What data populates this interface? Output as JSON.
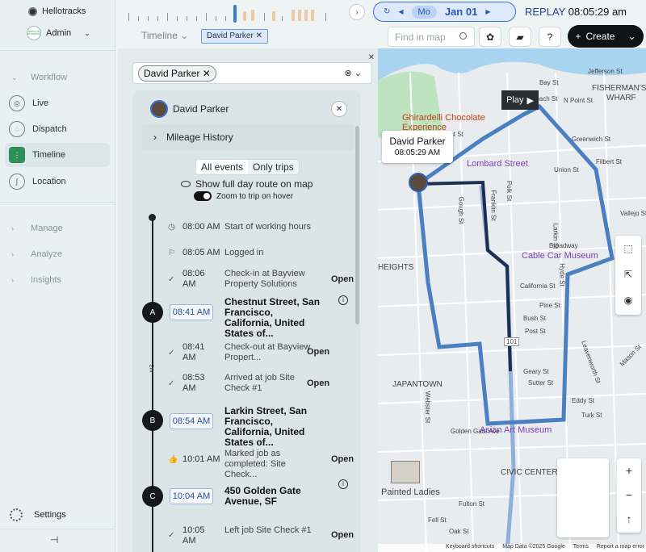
{
  "app": {
    "name": "Hellotracks",
    "account": "Admin",
    "account_badge": "IMPROVE BUSINESS"
  },
  "nav": {
    "workflow": "Workflow",
    "items": [
      {
        "label": "Live",
        "icon": "live-icon"
      },
      {
        "label": "Dispatch",
        "icon": "dispatch-icon"
      },
      {
        "label": "Timeline",
        "icon": "timeline-icon"
      },
      {
        "label": "Location",
        "icon": "location-icon"
      }
    ],
    "groups": [
      "Manage",
      "Analyze",
      "Insights"
    ],
    "settings": "Settings"
  },
  "topbar": {
    "mode": "Mo",
    "date": "Jan 01",
    "replay_label": "REPLAY",
    "replay_time": "08:05:29 am"
  },
  "toolbar": {
    "timeline_link": "Timeline",
    "chip": "David Parker",
    "search_placeholder": "Find in map",
    "help": "?",
    "create_label": "Create"
  },
  "panel": {
    "filter_chip": "David Parker",
    "driver_name": "David Parker",
    "mileage": "Mileage History",
    "tabs": [
      "All events",
      "Only trips"
    ],
    "show_full_day": "Show full day route on map",
    "zoom_on_hover": "Zoom to trip on hover",
    "trip_duration": "2m",
    "events": [
      {
        "time": "08:00 AM",
        "text": "Start of working hours"
      },
      {
        "time": "08:05 AM",
        "text": "Logged in"
      },
      {
        "time": "08:06 AM",
        "text": "Check-in at Bayview Property Solutions",
        "action": "Open"
      },
      {
        "time": "08:41 AM",
        "text": "Check-out at Bayview Propert...",
        "action": "Open"
      },
      {
        "time": "08:53 AM",
        "text": "Arrived at job Site Check #1",
        "action": "Open"
      },
      {
        "time": "10:01 AM",
        "text": "Marked job as completed: Site Check...",
        "action": "Open"
      },
      {
        "time": "10:05 AM",
        "text": "Left job Site Check #1",
        "action": "Open"
      }
    ],
    "stops": [
      {
        "marker": "A",
        "time": "08:41 AM",
        "address": "Chestnut Street, San Francisco, California, United States of..."
      },
      {
        "marker": "B",
        "time": "08:54 AM",
        "address": "Larkin Street, San Francisco, California, United States of..."
      },
      {
        "marker": "C",
        "time": "10:04 AM",
        "address": "450 Golden Gate Avenue, SF"
      }
    ]
  },
  "map": {
    "tooltip_name": "David Parker",
    "tooltip_time": "08:05:29 AM",
    "play_label": "Play",
    "labels": [
      "FISHERMAN'S",
      "WHARF",
      "HEIGHTS",
      "JAPANTOWN",
      "CIVIC CENTER",
      "Painted Ladies",
      "Polk St",
      "Gough St",
      "Franklin St",
      "Hyde St",
      "Larkin St",
      "Leavenworth St",
      "Geary St",
      "Bush St",
      "Post St",
      "Pine St",
      "Sutter St",
      "Webster St",
      "Union St",
      "Vallejo St",
      "Greenwich St",
      "Filbert St",
      "Mason St",
      "Eddy St",
      "Turk St",
      "Fell St",
      "Oak St",
      "Fulton St",
      "Golden Gate Ave",
      "California St",
      "Broadway",
      "Chestnut St",
      "Bay St",
      "Jefferson St",
      "N Point St",
      "Beach St"
    ],
    "poi": [
      "Ghirardelli Chocolate Experience",
      "Lombard Street",
      "Cable Car Museum",
      "Asian Art Museum"
    ],
    "highway": "101",
    "attribution": [
      "Keyboard shortcuts",
      "Map Data ©2025 Google",
      "Terms",
      "Report a map error"
    ]
  },
  "colors": {
    "accent": "#3a6ed6",
    "route": "#4a7fc1",
    "active_nav": "#2f8f5b",
    "create_bg": "#101214"
  }
}
